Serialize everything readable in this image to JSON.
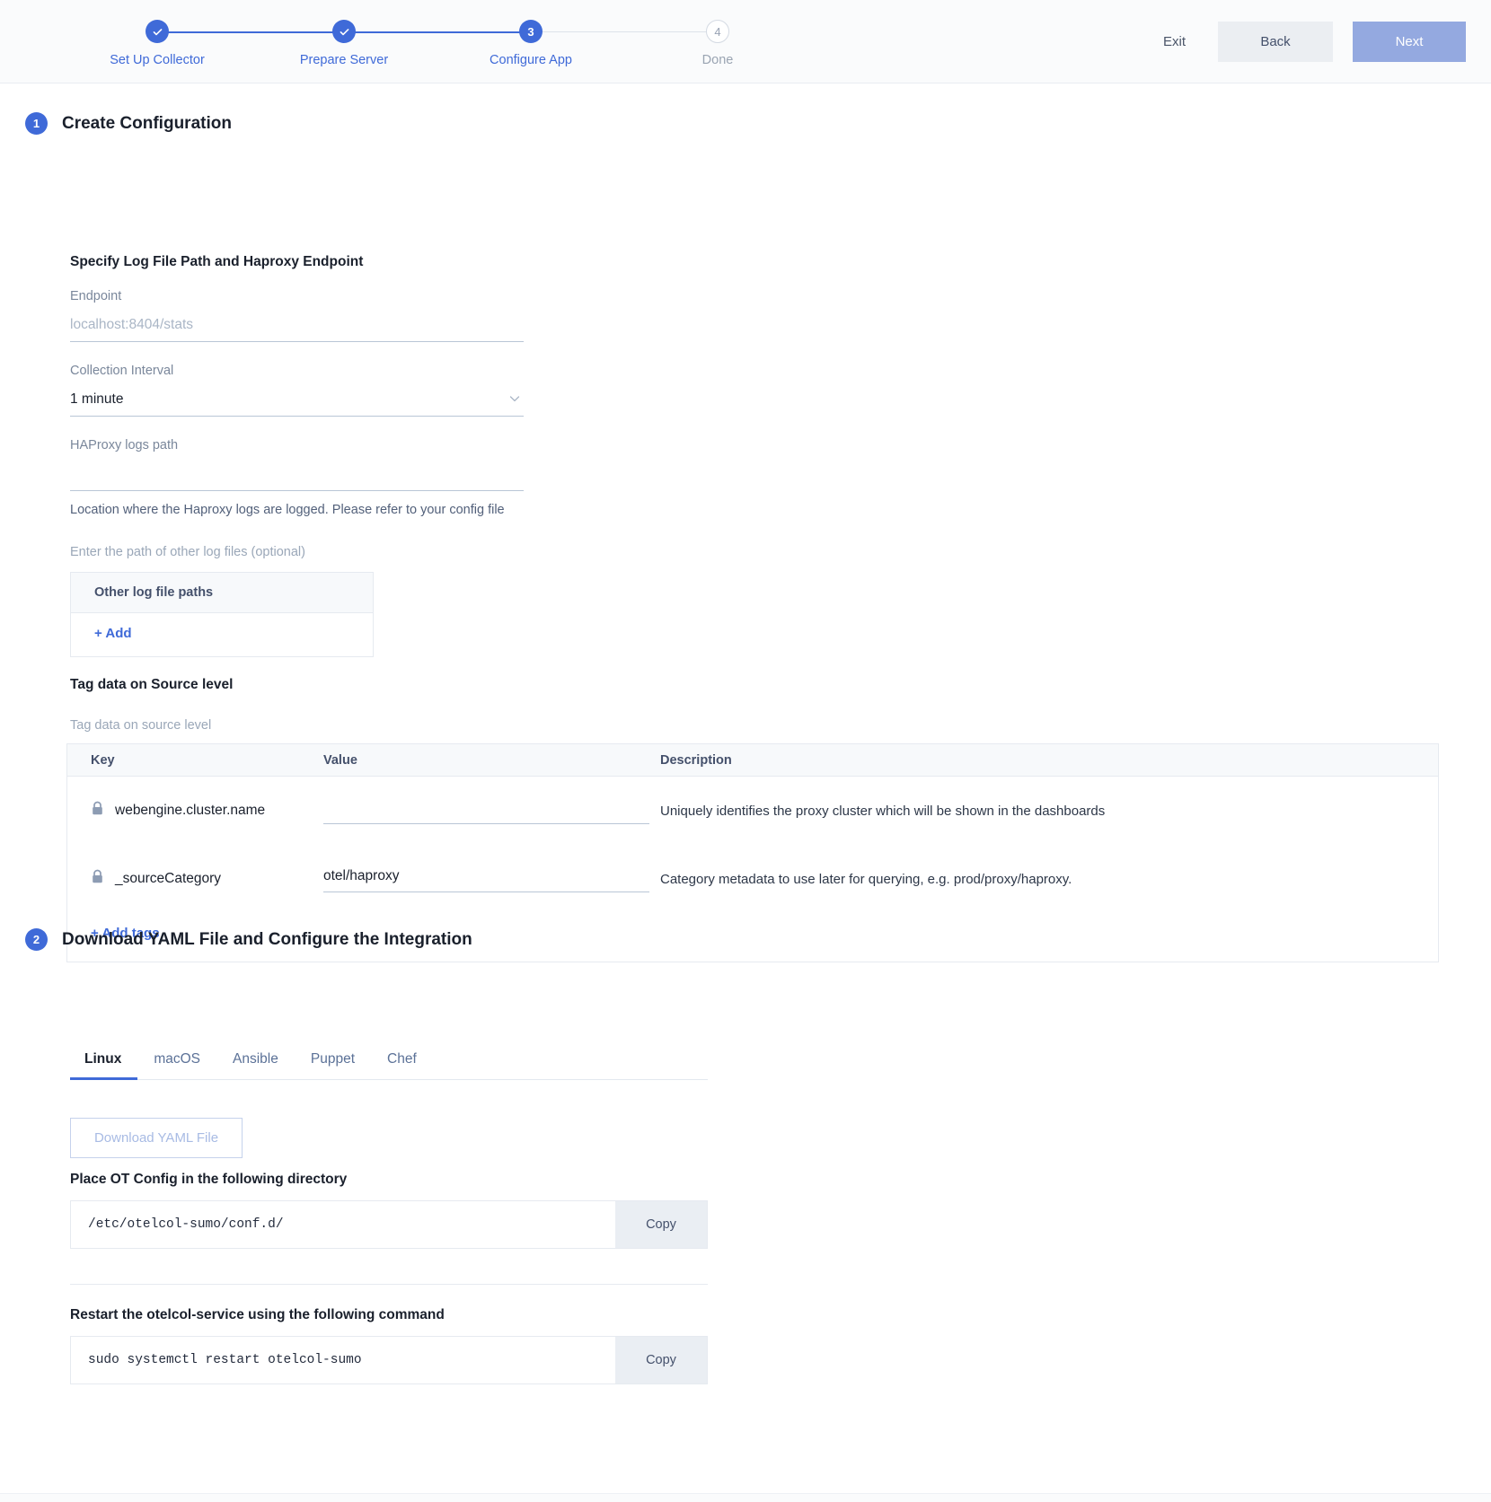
{
  "header": {
    "steps": [
      {
        "label": "Set Up Collector",
        "state": "done",
        "marker": "check"
      },
      {
        "label": "Prepare Server",
        "state": "done",
        "marker": "check"
      },
      {
        "label": "Configure App",
        "state": "current",
        "marker": "3"
      },
      {
        "label": "Done",
        "state": "pending",
        "marker": "4"
      }
    ],
    "exit_label": "Exit",
    "back_label": "Back",
    "next_label": "Next",
    "accent_color": "#3f6ad8",
    "next_bg": "#94a9e0"
  },
  "section1": {
    "number": "1",
    "title": "Create Configuration",
    "subtitle": "Specify Log File Path and Haproxy Endpoint",
    "endpoint": {
      "label": "Endpoint",
      "value": "",
      "placeholder": "localhost:8404/stats"
    },
    "collection_interval": {
      "label": "Collection Interval",
      "value": "1 minute",
      "options": [
        "1 minute"
      ]
    },
    "logs_path": {
      "label": "HAProxy logs path",
      "value": "",
      "placeholder": "",
      "helper": "Location where the Haproxy logs are logged. Please refer to your config file"
    },
    "other_logs": {
      "optional_label": "Enter the path of other log files (optional)",
      "column_header": "Other log file paths",
      "add_label": "+ Add"
    },
    "tags_section": {
      "title": "Tag data on Source level",
      "caption": "Tag data on source level",
      "columns": [
        "Key",
        "Value",
        "Description"
      ],
      "rows": [
        {
          "locked": true,
          "key": "webengine.cluster.name",
          "value": "",
          "description": "Uniquely identifies the proxy cluster which will be shown in the dashboards"
        },
        {
          "locked": true,
          "key": "_sourceCategory",
          "value": "otel/haproxy",
          "description": "Category metadata to use later for querying, e.g. prod/proxy/haproxy."
        }
      ],
      "add_tags_label": "+ Add tags"
    }
  },
  "section2": {
    "number": "2",
    "title": "Download YAML File and Configure the Integration",
    "heading": "Download YAML File and Configure the Integration",
    "tabs": [
      {
        "label": "Linux",
        "active": true
      },
      {
        "label": "macOS",
        "active": false
      },
      {
        "label": "Ansible",
        "active": false
      },
      {
        "label": "Puppet",
        "active": false
      },
      {
        "label": "Chef",
        "active": false
      }
    ],
    "download_label": "Download YAML File",
    "directory_block": {
      "title": "Place OT Config in the following directory",
      "code": "/etc/otelcol-sumo/conf.d/",
      "copy_label": "Copy"
    },
    "restart_block": {
      "title": "Restart the otelcol-service using the following command",
      "code": "sudo systemctl restart otelcol-sumo",
      "copy_label": "Copy"
    }
  }
}
